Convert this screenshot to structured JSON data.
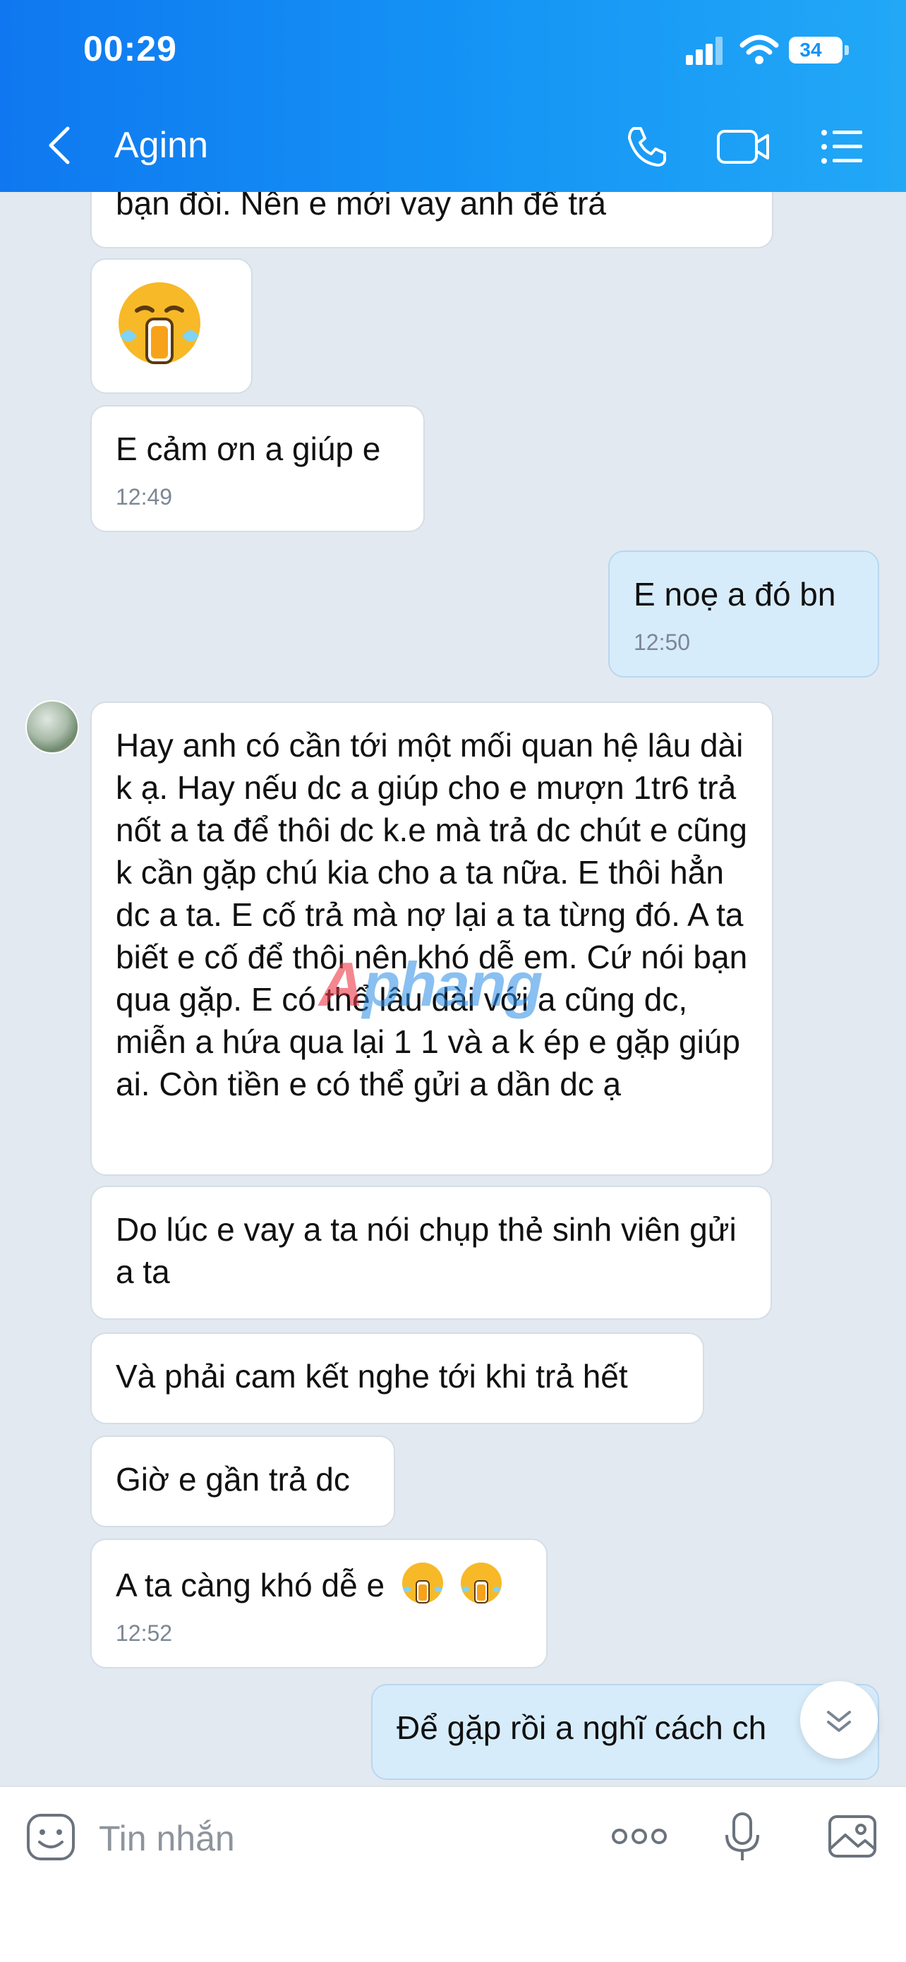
{
  "status_bar": {
    "time": "00:29",
    "battery": "34"
  },
  "header": {
    "contact_name": "Aginn"
  },
  "messages": {
    "m0": "bạn đòi. Nên e mới vay anh để trả",
    "m2": {
      "text": "E cảm ơn a giúp e",
      "time": "12:49"
    },
    "m3": {
      "text": "E noẹ a đó bn",
      "time": "12:50"
    },
    "m4": "Hay anh có cần tới một mối quan hệ lâu dài k ạ. Hay nếu dc a giúp cho e mượn 1tr6 trả nốt a ta để thôi dc k.e mà trả dc chút e cũng k cần gặp chú kia cho a ta nữa. E thôi hẳn dc a ta. E cố trả mà nợ lại a ta từng đó. A ta biết e cố để thôi nên khó dễ em. Cứ nói bạn qua gặp. E có thể lâu dài với a cũng dc, miễn a hứa qua lại 1 1 và a k ép e gặp giúp ai. Còn tiền e có thể gửi a dần dc ạ",
    "m5": "Do lúc e vay a ta nói chụp thẻ sinh viên gửi a ta",
    "m6": "Và phải cam kết nghe tới khi trả hết",
    "m7": "Giờ e gần trả dc",
    "m8": {
      "text": "A ta càng khó dễ e",
      "time": "12:52"
    },
    "m9": "Để gặp rồi a nghĩ cách ch"
  },
  "watermark": {
    "first": "A",
    "rest": "phang"
  },
  "composer": {
    "placeholder": "Tin nhắn"
  },
  "icons": [
    "back-chevron-icon",
    "phone-icon",
    "video-icon",
    "menu-list-icon",
    "sticker-icon",
    "more-icon",
    "mic-icon",
    "image-icon",
    "crying-emoji-icon",
    "chevron-down-icon"
  ],
  "colors": {
    "header_start": "#0f78f0",
    "header_end": "#22a8f7",
    "outgoing_bubble": "#d7ecfb",
    "chat_bg": "#e2e9f1"
  }
}
